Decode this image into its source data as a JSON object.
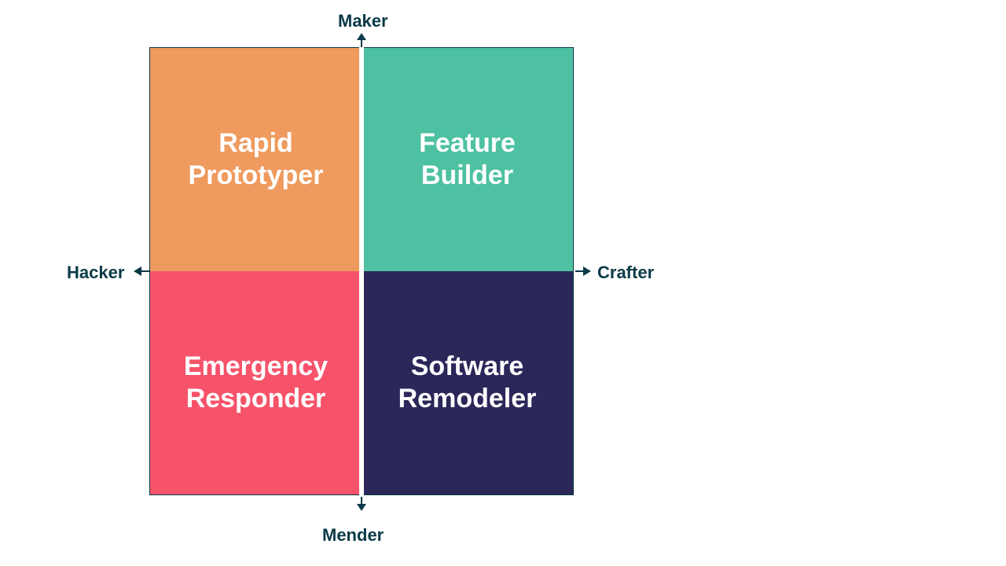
{
  "chart_data": {
    "type": "quadrant",
    "axes": {
      "top": "Maker",
      "bottom": "Mender",
      "left": "Hacker",
      "right": "Crafter"
    },
    "quadrants": {
      "top_left": {
        "label": "Rapid\nPrototyper",
        "color": "#ef9a5e"
      },
      "top_right": {
        "label": "Feature\nBuilder",
        "color": "#4dc1a1"
      },
      "bottom_left": {
        "label": "Emergency\nResponder",
        "color": "#f6536a"
      },
      "bottom_right": {
        "label": "Software\nRemodeler",
        "color": "#2b2759"
      }
    }
  }
}
